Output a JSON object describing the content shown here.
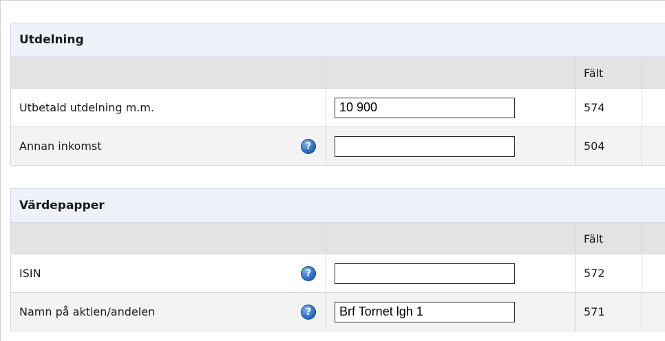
{
  "utdelning": {
    "title": "Utdelning",
    "falt_header": "Fält",
    "rows": [
      {
        "label": "Utbetald utdelning m.m.",
        "value": "10 900",
        "falt": "574"
      },
      {
        "label": "Annan inkomst",
        "value": "",
        "falt": "504",
        "help_icon": "question-mark-icon"
      }
    ]
  },
  "vardepapper": {
    "title": "Värdepapper",
    "falt_header": "Fält",
    "rows": [
      {
        "label": "ISIN",
        "value": "",
        "falt": "572",
        "help_icon": "question-mark-icon"
      },
      {
        "label": "Namn på aktien/andelen",
        "value": "Brf Tornet lgh 1",
        "falt": "571",
        "help_icon": "question-mark-icon"
      }
    ]
  },
  "colors": {
    "section_header_bg": "#eef2f8",
    "column_header_bg": "#e3e3e3",
    "help_icon_blue": "#2f74c9"
  }
}
